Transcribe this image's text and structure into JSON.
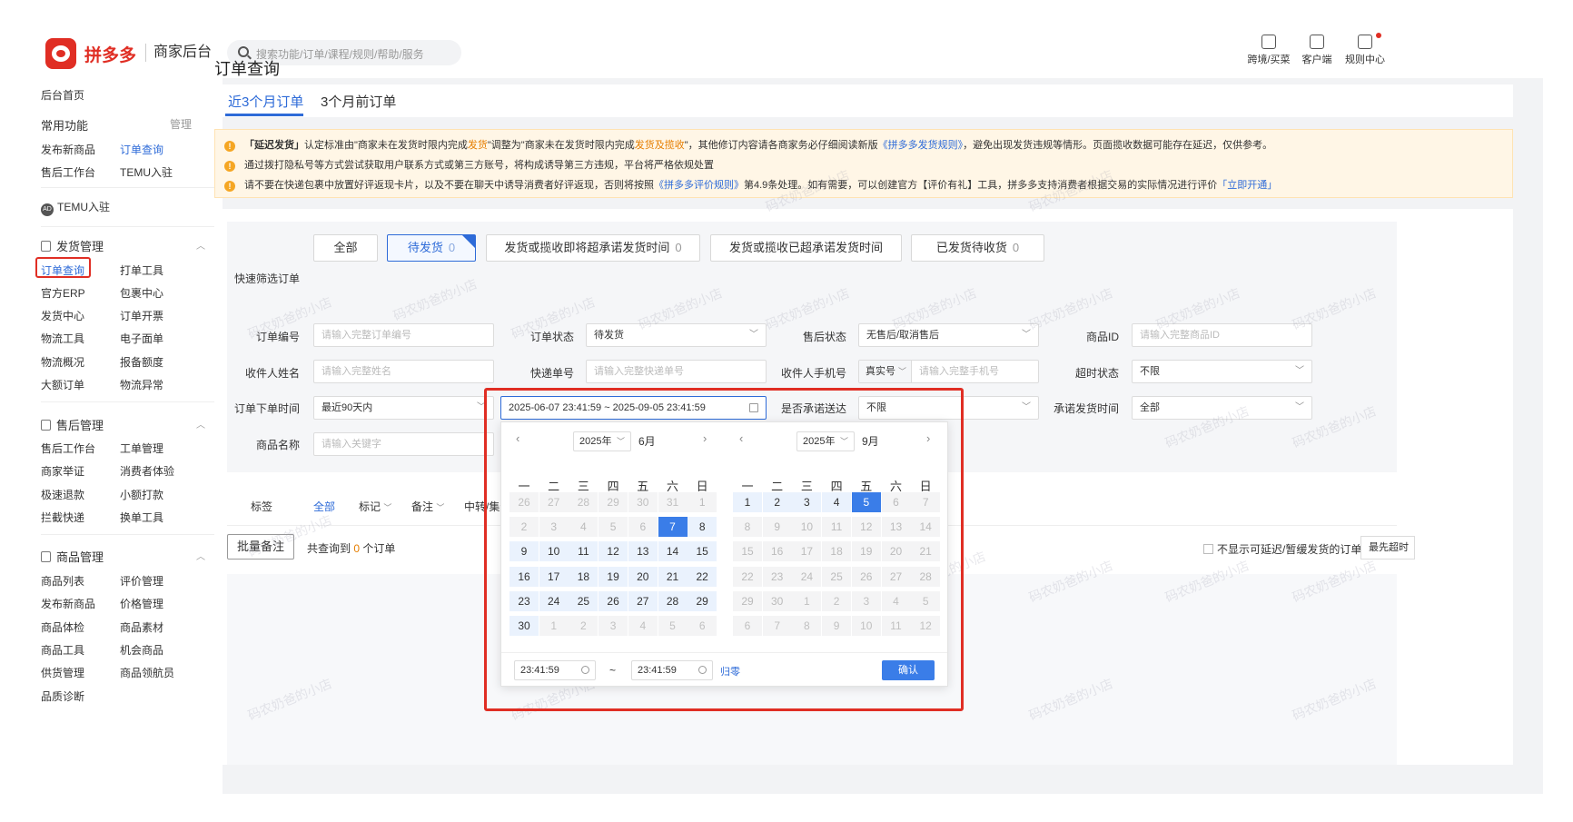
{
  "header": {
    "brand": "拼多多",
    "brand_sub": "商家后台",
    "search_placeholder": "搜索功能/订单/课程/规则/帮助/服务",
    "tools": [
      {
        "label": "跨境/买菜",
        "icon": "store-icon"
      },
      {
        "label": "客户端",
        "icon": "desktop-client-icon"
      },
      {
        "label": "规则中心",
        "icon": "rules-icon"
      }
    ]
  },
  "sidebar": {
    "home": "后台首页",
    "common_title": "常用功能",
    "common_manage": "管理",
    "common": [
      "发布新商品",
      "订单查询",
      "售后工作台",
      "TEMU入驻"
    ],
    "temu": "TEMU入驻",
    "temu_badge": "AD",
    "sections": [
      {
        "title": "发货管理",
        "items": [
          "订单查询",
          "打单工具",
          "官方ERP",
          "包裹中心",
          "发货中心",
          "订单开票",
          "物流工具",
          "电子面单",
          "物流概况",
          "报备额度",
          "大额订单",
          "物流异常"
        ]
      },
      {
        "title": "售后管理",
        "items": [
          "售后工作台",
          "工单管理",
          "商家举证",
          "消费者体验",
          "极速退款",
          "小额打款",
          "拦截快递",
          "换单工具"
        ]
      },
      {
        "title": "商品管理",
        "items": [
          "商品列表",
          "评价管理",
          "发布新商品",
          "价格管理",
          "商品体检",
          "商品素材",
          "商品工具",
          "机会商品",
          "供货管理",
          "商品领航员",
          "品质诊断"
        ]
      }
    ]
  },
  "main": {
    "title": "订单查询",
    "tabs": [
      "近3个月订单",
      "3个月前订单"
    ],
    "notices": {
      "n1_a": "「延迟发货」",
      "n1_b": "认定标准由\"商家未在发货时限内完成",
      "n1_c": "发货",
      "n1_d": "\"调整为\"商家未在发货时限内完成",
      "n1_e": "发货及揽收",
      "n1_f": "\"，其他修订内容请各商家务必仔细阅读新版",
      "n1_g": "《拼多多发货规则》",
      "n1_h": "，避免出现发货违规等情形。页面揽收数据可能存在延迟，仅供参考。",
      "n2": "通过拨打隐私号等方式尝试获取用户联系方式或第三方账号，将构成诱导第三方违规，平台将严格依规处置",
      "n3_a": "请不要在快递包裹中放置好评返现卡片，以及不要在聊天中诱导消费者好评返现，否则将按照",
      "n3_b": "《拼多多评价规则》",
      "n3_c": "第4.9条处理。如有需要，可以创建官方【评价有礼】工具，拼多多支持消费者根据交易的实际情况进行评价",
      "n3_d": "「立即开通」"
    },
    "quick": {
      "label": "快速筛选订单",
      "buttons": [
        {
          "label": "全部",
          "count": ""
        },
        {
          "label": "待发货",
          "count": "0"
        },
        {
          "label": "发货或揽收即将超承诺发货时间",
          "count": "0"
        },
        {
          "label": "发货或揽收已超承诺发货时间",
          "count": ""
        },
        {
          "label": "已发货待收货",
          "count": "0"
        }
      ]
    },
    "filters": {
      "order_no_label": "订单编号",
      "order_no_ph": "请输入完整订单编号",
      "status_label": "订单状态",
      "status_val": "待发货",
      "aftersale_label": "售后状态",
      "aftersale_val": "无售后/取消售后",
      "goods_id_label": "商品ID",
      "goods_id_ph": "请输入完整商品ID",
      "receiver_label": "收件人姓名",
      "receiver_ph": "请输入完整姓名",
      "express_label": "快递单号",
      "express_ph": "请输入完整快递单号",
      "phone_label": "收件人手机号",
      "phone_type": "真实号",
      "phone_ph": "请输入完整手机号",
      "timeout_label": "超时状态",
      "timeout_val": "不限",
      "time_label": "订单下单时间",
      "time_preset": "最近90天内",
      "range": "2025-06-07 23:41:59 ~ 2025-09-05 23:41:59",
      "promise_label": "是否承诺送达",
      "promise_val": "不限",
      "promise_time_label": "承诺发货时间",
      "promise_time_val": "全部",
      "goods_name_label": "商品名称",
      "goods_name_ph": "请输入关键字"
    },
    "tags": {
      "label": "标签",
      "all": "全部",
      "mark": "标记",
      "remark": "备注",
      "transfer": "中转/集运"
    },
    "batch_btn": "批量备注",
    "found_prefix": "共查询到",
    "found_count": "0",
    "found_suffix": "个订单",
    "hide_delay": "不显示可延迟/暂缓发货的订单",
    "sort": "最先超时"
  },
  "datepicker": {
    "weekdays": [
      "一",
      "二",
      "三",
      "四",
      "五",
      "六",
      "日"
    ],
    "left": {
      "year": "2025年",
      "month": "6月",
      "days": [
        26,
        27,
        28,
        29,
        30,
        31,
        1,
        2,
        3,
        4,
        5,
        6,
        7,
        8,
        9,
        10,
        11,
        12,
        13,
        14,
        15,
        16,
        17,
        18,
        19,
        20,
        21,
        22,
        23,
        24,
        25,
        26,
        27,
        28,
        29,
        30,
        1,
        2,
        3,
        4,
        5,
        6
      ],
      "first_in": 6,
      "last_in": 35,
      "range_start": 7,
      "range_end": 30
    },
    "right": {
      "year": "2025年",
      "month": "9月",
      "days": [
        1,
        2,
        3,
        4,
        5,
        6,
        7,
        8,
        9,
        10,
        11,
        12,
        13,
        14,
        15,
        16,
        17,
        18,
        19,
        20,
        21,
        22,
        23,
        24,
        25,
        26,
        27,
        28,
        29,
        30,
        1,
        2,
        3,
        4,
        5,
        6,
        7,
        8,
        9,
        10,
        11,
        12
      ],
      "first_in": 0,
      "last_in": 29,
      "range_start": 1,
      "range_end": 5
    },
    "start_time": "23:41:59",
    "end_time": "23:41:59",
    "tilde": "~",
    "reset": "归零",
    "confirm": "确认"
  },
  "watermark": "码农奶爸的小店",
  "colors": {
    "accent": "#2e6bd8",
    "brand": "#e02e24",
    "warn": "#f5a623"
  }
}
